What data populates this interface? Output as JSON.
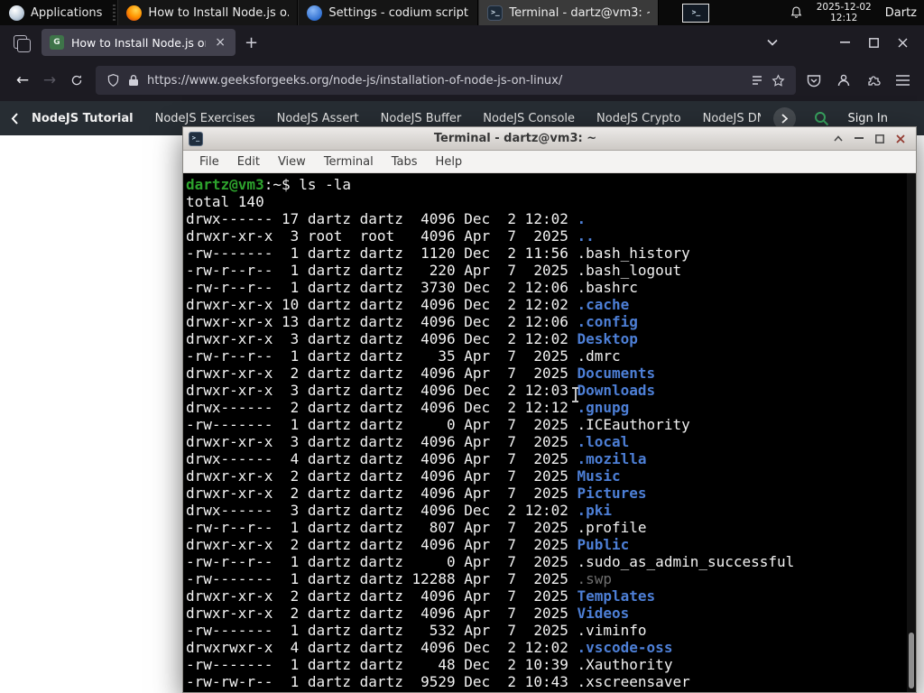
{
  "colors": {
    "gfg_green": "#2f8d46",
    "terminal_dir_blue": "#4d7fd6",
    "terminal_prompt_green": "#2da32d",
    "terminal_dim_gray": "#6f6f6f",
    "firefox_dark": "#1c1b22",
    "active_tab": "#42414d"
  },
  "glyphs": {
    "back": "←",
    "forward": "→",
    "new_tab": "+",
    "tab_close": "×",
    "terminal_icon_text": ">_"
  },
  "panel": {
    "applications_label": "Applications",
    "tasks": [
      {
        "title": "How to Install Node.js o...",
        "icon": "firefox",
        "active": false
      },
      {
        "title": "Settings - codium script...",
        "icon": "settings",
        "active": false
      },
      {
        "title": "Terminal - dartz@vm3: ~",
        "icon": "terminal",
        "active": true
      }
    ],
    "clock_date": "2025-12-02",
    "clock_time": "12:12",
    "user": "Dartz"
  },
  "browser": {
    "tab_title": "How to Install Node.js on",
    "url": "https://www.geeksforgeeks.org/node-js/installation-of-node-js-on-linux/",
    "site_nav": {
      "back_item": "NodeJS Tutorial",
      "items": [
        "NodeJS Exercises",
        "NodeJS Assert",
        "NodeJS Buffer",
        "NodeJS Console",
        "NodeJS Crypto",
        "NodeJS DNS",
        "Node"
      ],
      "sign_in": "Sign In"
    }
  },
  "terminal": {
    "title": "Terminal - dartz@vm3: ~",
    "menu": [
      "File",
      "Edit",
      "View",
      "Terminal",
      "Tabs",
      "Help"
    ],
    "prompt_user": "dartz@vm3",
    "prompt_suffix": ":~$ ",
    "command": "ls -la",
    "total_line": "total 140",
    "rows": [
      {
        "p": "drwx------ 17 dartz dartz  4096 Dec  2 12:02 ",
        "n": ".",
        "c": "dir"
      },
      {
        "p": "drwxr-xr-x  3 root  root   4096 Apr  7  2025 ",
        "n": "..",
        "c": "dir"
      },
      {
        "p": "-rw-------  1 dartz dartz  1120 Dec  2 11:56 ",
        "n": ".bash_history",
        "c": "plain"
      },
      {
        "p": "-rw-r--r--  1 dartz dartz   220 Apr  7  2025 ",
        "n": ".bash_logout",
        "c": "plain"
      },
      {
        "p": "-rw-r--r--  1 dartz dartz  3730 Dec  2 12:06 ",
        "n": ".bashrc",
        "c": "plain"
      },
      {
        "p": "drwxr-xr-x 10 dartz dartz  4096 Dec  2 12:02 ",
        "n": ".cache",
        "c": "dir"
      },
      {
        "p": "drwxr-xr-x 13 dartz dartz  4096 Dec  2 12:06 ",
        "n": ".config",
        "c": "dir"
      },
      {
        "p": "drwxr-xr-x  3 dartz dartz  4096 Dec  2 12:02 ",
        "n": "Desktop",
        "c": "dir"
      },
      {
        "p": "-rw-r--r--  1 dartz dartz    35 Apr  7  2025 ",
        "n": ".dmrc",
        "c": "plain"
      },
      {
        "p": "drwxr-xr-x  2 dartz dartz  4096 Apr  7  2025 ",
        "n": "Documents",
        "c": "dir"
      },
      {
        "p": "drwxr-xr-x  3 dartz dartz  4096 Dec  2 12:03 ",
        "n": "Downloads",
        "c": "dir"
      },
      {
        "p": "drwx------  2 dartz dartz  4096 Dec  2 12:12 ",
        "n": ".gnupg",
        "c": "dir"
      },
      {
        "p": "-rw-------  1 dartz dartz     0 Apr  7  2025 ",
        "n": ".ICEauthority",
        "c": "plain"
      },
      {
        "p": "drwxr-xr-x  3 dartz dartz  4096 Apr  7  2025 ",
        "n": ".local",
        "c": "dir"
      },
      {
        "p": "drwx------  4 dartz dartz  4096 Apr  7  2025 ",
        "n": ".mozilla",
        "c": "dir"
      },
      {
        "p": "drwxr-xr-x  2 dartz dartz  4096 Apr  7  2025 ",
        "n": "Music",
        "c": "dir"
      },
      {
        "p": "drwxr-xr-x  2 dartz dartz  4096 Apr  7  2025 ",
        "n": "Pictures",
        "c": "dir"
      },
      {
        "p": "drwx------  3 dartz dartz  4096 Dec  2 12:02 ",
        "n": ".pki",
        "c": "dir"
      },
      {
        "p": "-rw-r--r--  1 dartz dartz   807 Apr  7  2025 ",
        "n": ".profile",
        "c": "plain"
      },
      {
        "p": "drwxr-xr-x  2 dartz dartz  4096 Apr  7  2025 ",
        "n": "Public",
        "c": "dir"
      },
      {
        "p": "-rw-r--r--  1 dartz dartz     0 Apr  7  2025 ",
        "n": ".sudo_as_admin_successful",
        "c": "plain"
      },
      {
        "p": "-rw-------  1 dartz dartz 12288 Apr  7  2025 ",
        "n": ".swp",
        "c": "dim"
      },
      {
        "p": "drwxr-xr-x  2 dartz dartz  4096 Apr  7  2025 ",
        "n": "Templates",
        "c": "dir"
      },
      {
        "p": "drwxr-xr-x  2 dartz dartz  4096 Apr  7  2025 ",
        "n": "Videos",
        "c": "dir"
      },
      {
        "p": "-rw-------  1 dartz dartz   532 Apr  7  2025 ",
        "n": ".viminfo",
        "c": "plain"
      },
      {
        "p": "drwxrwxr-x  4 dartz dartz  4096 Dec  2 12:02 ",
        "n": ".vscode-oss",
        "c": "dir"
      },
      {
        "p": "-rw-------  1 dartz dartz    48 Dec  2 10:39 ",
        "n": ".Xauthority",
        "c": "plain"
      },
      {
        "p": "-rw-rw-r--  1 dartz dartz  9529 Dec  2 10:43 ",
        "n": ".xscreensaver",
        "c": "plain"
      }
    ]
  }
}
